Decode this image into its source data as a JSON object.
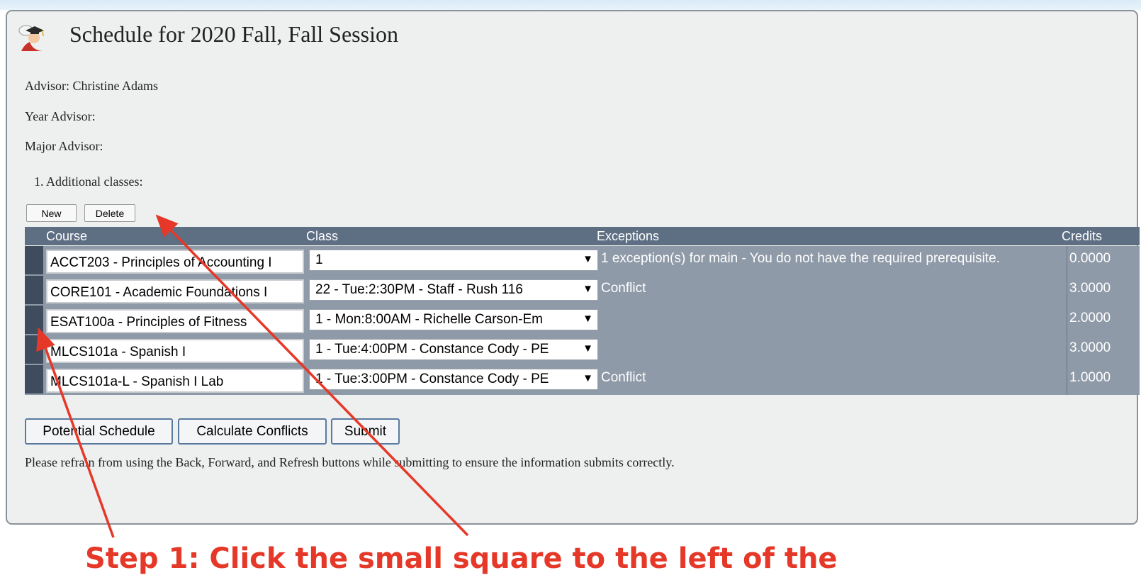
{
  "page": {
    "title": "Schedule for 2020 Fall, Fall Session",
    "advisor": "Advisor: Christine Adams",
    "year_advisor": "Year Advisor:",
    "major_advisor": "Major Advisor:",
    "section_label": "1. Additional classes:",
    "note": "Please refrain from using the Back, Forward, and Refresh buttons while submitting to ensure the information submits correctly."
  },
  "toolbar": {
    "new_label": "New",
    "delete_label": "Delete"
  },
  "grid": {
    "headers": {
      "course": "Course",
      "class": "Class",
      "exceptions": "Exceptions",
      "credits": "Credits"
    },
    "rows": [
      {
        "course": "ACCT203 - Principles of Accounting I",
        "class": "1",
        "exceptions": "1 exception(s) for main - You do not have the required prerequisite.",
        "credits": "0.0000"
      },
      {
        "course": "CORE101 - Academic Foundations I",
        "class": "22 - Tue:2:30PM - Staff - Rush 116",
        "exceptions": "Conflict",
        "credits": "3.0000"
      },
      {
        "course": "ESAT100a - Principles of Fitness",
        "class": "1 - Mon:8:00AM - Richelle Carson-Em",
        "exceptions": "",
        "credits": "2.0000"
      },
      {
        "course": "MLCS101a - Spanish I",
        "class": "1 - Tue:4:00PM - Constance Cody - PE",
        "exceptions": "",
        "credits": "3.0000"
      },
      {
        "course": "MLCS101a-L - Spanish I Lab",
        "class": "1 - Tue:3:00PM - Constance Cody - PE",
        "exceptions": "Conflict",
        "credits": "1.0000"
      }
    ]
  },
  "actions": {
    "potential_schedule": "Potential Schedule",
    "calculate_conflicts": "Calculate Conflicts",
    "submit": "Submit"
  },
  "annotation": {
    "caption": "Step 1: Click the small square to the left of the",
    "color": "#e53828"
  },
  "icons": {
    "title_icon": "graduate-avatar-icon",
    "dropdown_caret": "▼"
  },
  "colors": {
    "grid_header": "#5e6f84",
    "grid_row": "#8f9aa8",
    "row_selector": "#3e4c5e",
    "button_border": "#5a7aa0"
  }
}
